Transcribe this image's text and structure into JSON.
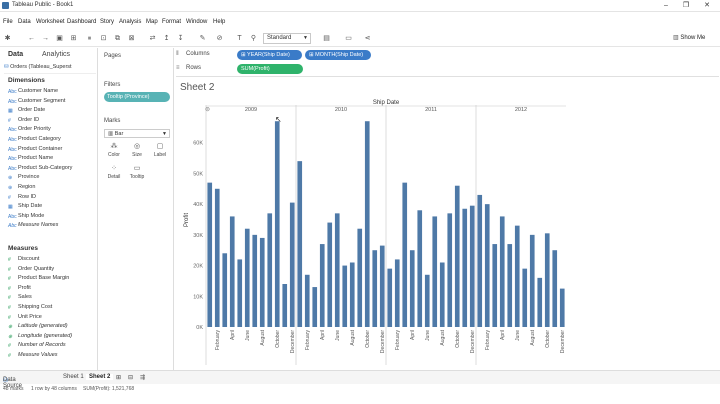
{
  "window": {
    "title": "Tableau Public - Book1",
    "min": "–",
    "max": "❐",
    "close": "✕"
  },
  "menu": [
    "File",
    "Data",
    "Worksheet",
    "Dashboard",
    "Story",
    "Analysis",
    "Map",
    "Format",
    "Window",
    "Help"
  ],
  "toolbar": {
    "fit": "Standard",
    "show_me": "Show Me"
  },
  "data_pane": {
    "tab_data": "Data",
    "tab_analytics": "Analytics",
    "datasource": "Orders (Tableau_Superst",
    "dimensions_title": "Dimensions",
    "dimensions": [
      {
        "icon": "Abc",
        "label": "Customer Name",
        "italic": false
      },
      {
        "icon": "Abc",
        "label": "Customer Segment",
        "italic": false
      },
      {
        "icon": "▦",
        "label": "Order Date",
        "italic": false
      },
      {
        "icon": "#",
        "label": "Order ID",
        "italic": false
      },
      {
        "icon": "Abc",
        "label": "Order Priority",
        "italic": false
      },
      {
        "icon": "Abc",
        "label": "Product Category",
        "italic": false
      },
      {
        "icon": "Abc",
        "label": "Product Container",
        "italic": false
      },
      {
        "icon": "Abc",
        "label": "Product Name",
        "italic": false
      },
      {
        "icon": "Abc",
        "label": "Product Sub-Category",
        "italic": false
      },
      {
        "icon": "⊕",
        "label": "Province",
        "italic": false
      },
      {
        "icon": "⊕",
        "label": "Region",
        "italic": false
      },
      {
        "icon": "#",
        "label": "Row ID",
        "italic": false
      },
      {
        "icon": "▦",
        "label": "Ship Date",
        "italic": false
      },
      {
        "icon": "Abc",
        "label": "Ship Mode",
        "italic": false
      },
      {
        "icon": "Abc",
        "label": "Measure Names",
        "italic": true
      }
    ],
    "measures_title": "Measures",
    "measures": [
      {
        "icon": "#",
        "label": "Discount",
        "italic": false
      },
      {
        "icon": "#",
        "label": "Order Quantity",
        "italic": false
      },
      {
        "icon": "#",
        "label": "Product Base Margin",
        "italic": false
      },
      {
        "icon": "#",
        "label": "Profit",
        "italic": false
      },
      {
        "icon": "#",
        "label": "Sales",
        "italic": false
      },
      {
        "icon": "#",
        "label": "Shipping Cost",
        "italic": false
      },
      {
        "icon": "#",
        "label": "Unit Price",
        "italic": false
      },
      {
        "icon": "⊕",
        "label": "Latitude (generated)",
        "italic": true
      },
      {
        "icon": "⊕",
        "label": "Longitude (generated)",
        "italic": true
      },
      {
        "icon": "#",
        "label": "Number of Records",
        "italic": true
      },
      {
        "icon": "#",
        "label": "Measure Values",
        "italic": true
      }
    ]
  },
  "cards": {
    "pages": "Pages",
    "filters": "Filters",
    "filter_pill": "Tooltip (Province)",
    "marks": "Marks",
    "mark_type": "Bar",
    "buttons": [
      "Color",
      "Size",
      "Label",
      "Detail",
      "Tooltip"
    ]
  },
  "shelves": {
    "columns_label": "Columns",
    "rows_label": "Rows",
    "col_pills": [
      "YEAR(Ship Date)",
      "MONTH(Ship Date)"
    ],
    "row_pills": [
      "SUM(Profit)"
    ]
  },
  "sheet": {
    "title": "Sheet 2"
  },
  "chart_data": {
    "type": "bar",
    "title": "Ship Date",
    "ylabel": "Profit",
    "ylim": [
      0,
      70000
    ],
    "yticks": [
      "0K",
      "10K",
      "20K",
      "30K",
      "40K",
      "50K",
      "60K"
    ],
    "years": [
      "2009",
      "2010",
      "2011",
      "2012"
    ],
    "month_labels": [
      "February",
      "April",
      "June",
      "August",
      "October",
      "December"
    ],
    "month_label_index": [
      1,
      3,
      5,
      7,
      9,
      11
    ],
    "values": [
      47000,
      45000,
      24000,
      36000,
      22000,
      32000,
      30000,
      29000,
      37000,
      67000,
      14000,
      40500,
      54000,
      17000,
      13000,
      27000,
      34000,
      37000,
      20000,
      21000,
      32000,
      67000,
      25000,
      26500,
      19000,
      22000,
      47000,
      25000,
      38000,
      17000,
      36000,
      21000,
      37000,
      46000,
      38500,
      39500,
      43000,
      40000,
      27000,
      36000,
      27000,
      33000,
      19000,
      30000,
      16000,
      30500,
      25000,
      12500
    ],
    "bar_color": "#4e79a7",
    "grid": false
  },
  "tabs": {
    "datasource": "Data Source",
    "sheet1": "Sheet 1",
    "sheet2": "Sheet 2"
  },
  "status": {
    "marks": "48 marks",
    "rows": "1 row by 48 columns",
    "sum": "SUM(Profit): 1,521,768"
  }
}
